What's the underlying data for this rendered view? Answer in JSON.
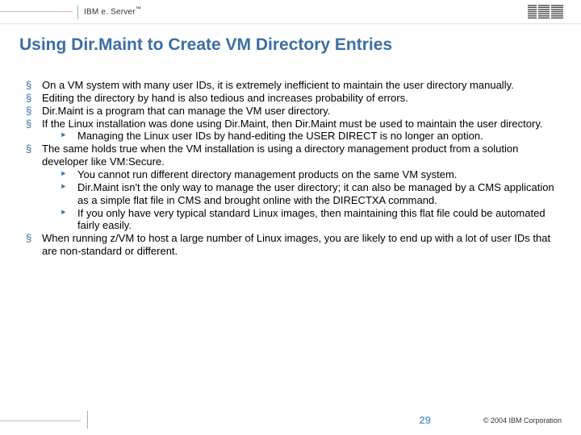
{
  "header": {
    "brand_prefix": "IBM e. Server",
    "brand_tm": "™"
  },
  "title": "Using Dir.Maint to Create VM Directory Entries",
  "bullets": [
    {
      "text": "On a VM system with many user IDs, it is extremely inefficient to maintain the user directory manually."
    },
    {
      "text": "Editing the directory by hand is also tedious and increases probability of errors."
    },
    {
      "text": "Dir.Maint is a program that can manage the VM user directory."
    },
    {
      "text": "If the Linux installation was done using Dir.Maint, then Dir.Maint must be used to maintain the user directory.",
      "sub": [
        "Managing the Linux user IDs by hand-editing the USER DIRECT is no longer an option."
      ]
    },
    {
      "text": "The same holds true when the VM installation is using a directory management product from a solution developer like VM:Secure.",
      "sub": [
        "You cannot run different directory management products on the same VM system.",
        "Dir.Maint isn't the only way to manage the user directory; it can also be managed by a CMS application as a simple flat file in CMS and brought online with the DIRECTXA command.",
        "If you only have very typical standard Linux images, then maintaining this flat file could be automated fairly easily."
      ]
    },
    {
      "text": "When running z/VM to host a large number of Linux images, you are likely to end up with a lot of user IDs that are non-standard or different."
    }
  ],
  "footer": {
    "page": "29",
    "copyright": "© 2004 IBM Corporation"
  }
}
